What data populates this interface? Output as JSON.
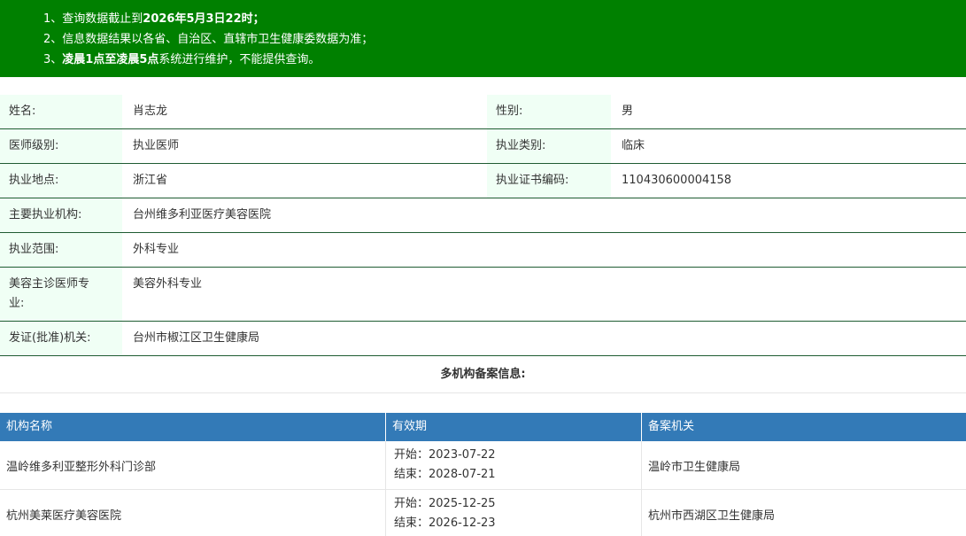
{
  "notice": {
    "line1_prefix": "1、查询数据截止到",
    "line1_bold": "2026年5月3日22时",
    "line1_suffix": "；",
    "line2": "2、信息数据结果以各省、自治区、直辖市卫生健康委数据为准；",
    "line3_prefix": "3、",
    "line3_bold": "凌晨1点至凌晨5点",
    "line3_suffix": "系统进行维护，不能提供查询。"
  },
  "doctor": {
    "name_label": "姓名:",
    "name": "肖志龙",
    "gender_label": "性别:",
    "gender": "男",
    "level_label": "医师级别:",
    "level": "执业医师",
    "category_label": "执业类别:",
    "category": "临床",
    "location_label": "执业地点:",
    "location": "浙江省",
    "cert_label": "执业证书编码:",
    "cert_no": "110430600004158",
    "institution_label": "主要执业机构:",
    "institution": "台州维多利亚医疗美容医院",
    "scope_label": "执业范围:",
    "scope": "外科专业",
    "cosmetic_label_1": "美容主诊医师专",
    "cosmetic_label_2": "业:",
    "cosmetic": "美容外科专业",
    "issuer_label": "发证(批准)机关:",
    "issuer": "台州市椒江区卫生健康局"
  },
  "multi": {
    "title": "多机构备案信息:",
    "headers": [
      "机构名称",
      "有效期",
      "备案机关"
    ],
    "rows": [
      {
        "name": "温岭维多利亚整形外科门诊部",
        "start": "开始：2023-07-22",
        "end": "结束：2028-07-21",
        "authority": "温岭市卫生健康局"
      },
      {
        "name": "杭州美莱医疗美容医院",
        "start": "开始：2025-12-25",
        "end": "结束：2026-12-23",
        "authority": "杭州市西湖区卫生健康局"
      }
    ]
  },
  "colors": {
    "notice_bg": "#008000",
    "table_header_bg": "#337ab7",
    "label_bg": "#f0fff5",
    "row_border": "#1f5c32"
  }
}
